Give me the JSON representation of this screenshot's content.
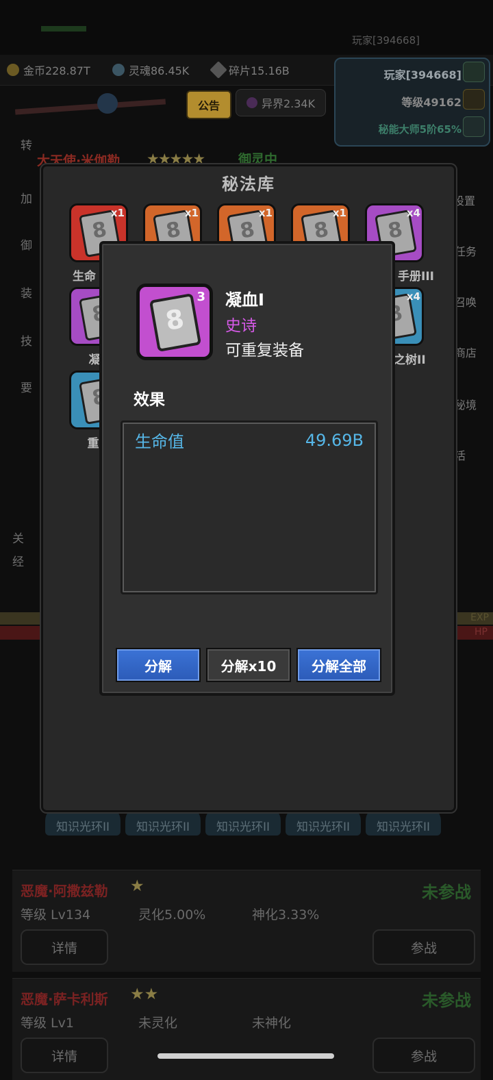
{
  "top": {
    "player_small": "玩家[394668]"
  },
  "resources": [
    {
      "icon": "gold-coin-icon",
      "label": "金币228.87T"
    },
    {
      "icon": "soul-icon",
      "label": "灵魂86.45K"
    },
    {
      "icon": "shard-icon",
      "label": "碎片15.16B"
    }
  ],
  "player_card": {
    "name": "玩家[394668]",
    "level": "等级49162",
    "rank": "秘能大师5阶65%"
  },
  "notice_button": "公告",
  "realm": "异界2.34K",
  "background_hero": {
    "name": "大天使·米伽勒",
    "stars": "★★★★★",
    "state": "御灵中"
  },
  "side_right_labels": [
    "设置",
    "任务",
    "召唤",
    "商店",
    "秘境",
    "活"
  ],
  "side_left_labels": [
    "转",
    "加",
    "御",
    "装",
    "技",
    "要",
    "关",
    "经"
  ],
  "bars": {
    "exp": "EXP",
    "hp": "HP"
  },
  "bg_tabs": [
    "知识光环II",
    "知识光环II",
    "知识光环II",
    "知识光环II",
    "知识光环II"
  ],
  "hero_cards": [
    {
      "name": "恶魔·阿撒兹勒",
      "stars": "★",
      "state": "未参战",
      "level": "等级 Lv134",
      "spirit": "灵化5.00%",
      "divine": "神化3.33%",
      "detail": "详情",
      "join": "参战"
    },
    {
      "name": "恶魔·萨卡利斯",
      "stars": "★★",
      "state": "未参战",
      "level": "等级 Lv1",
      "spirit": "未灵化",
      "divine": "未神化",
      "detail": "详情",
      "join": "参战"
    }
  ],
  "library": {
    "title": "秘法库",
    "slots": [
      {
        "count": "x1",
        "color": "#c9332a",
        "label": "生命"
      },
      {
        "count": "x1",
        "color": "#d2662a",
        "label": ""
      },
      {
        "count": "x1",
        "color": "#d2662a",
        "label": ""
      },
      {
        "count": "x1",
        "color": "#d2662a",
        "label": ""
      },
      {
        "count": "x4",
        "color": "#a64cc4",
        "label": "手册III"
      },
      {
        "count": "",
        "color": "#a64cc4",
        "label": "凝"
      },
      {
        "count": "x4",
        "color": "#3a8fb8",
        "label": "之树II"
      },
      {
        "count": "",
        "color": "#3a8fb8",
        "label": "重"
      }
    ]
  },
  "detail": {
    "level": "3",
    "name": "凝血I",
    "rarity": "史诗",
    "equip_note": "可重复装备",
    "effect_title": "效果",
    "effect": {
      "name": "生命值",
      "value": "49.69B"
    },
    "buttons": {
      "decompose": "分解",
      "decompose10": "分解x10",
      "decompose_all": "分解全部"
    }
  },
  "colors": {
    "epic": "#d65ae8",
    "stat": "#56b7e8",
    "button": "#3b73d6"
  }
}
